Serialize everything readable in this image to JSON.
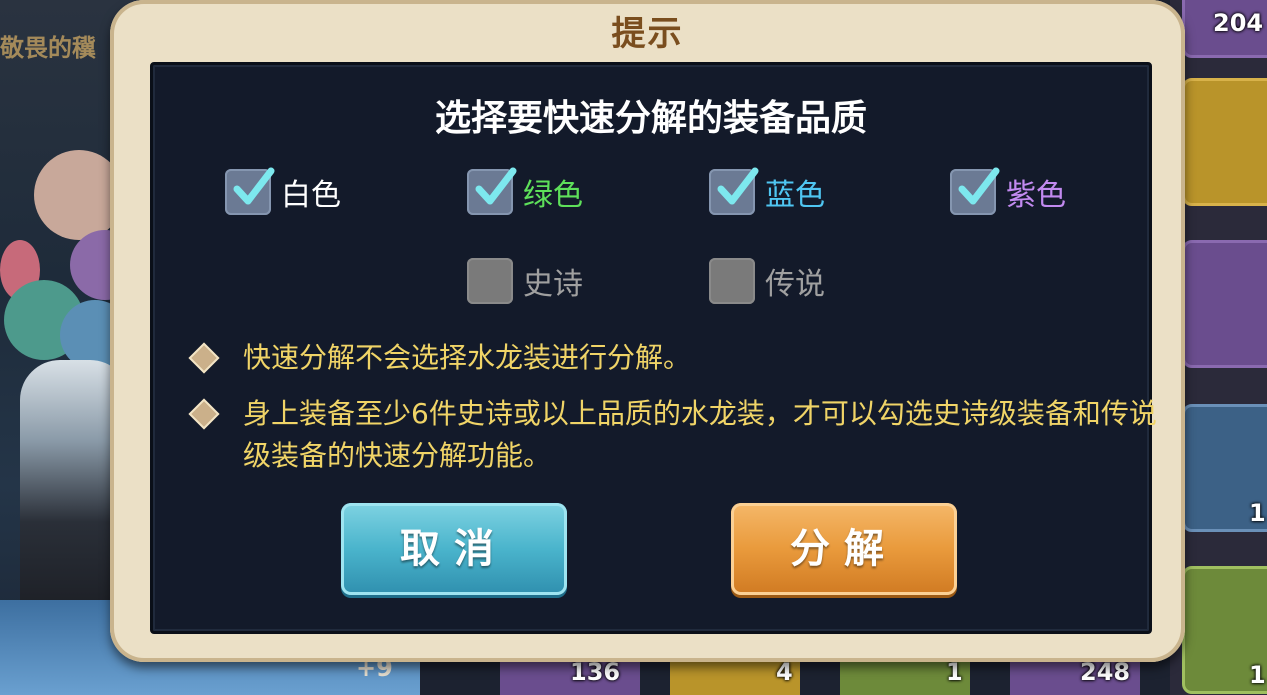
{
  "background": {
    "left_title": "敬畏的䆊",
    "bottom_enhance": "+9",
    "right_slot_counts": [
      "204",
      "1",
      "1"
    ],
    "bottom_slot_counts": [
      "136",
      "4",
      "1",
      "248"
    ]
  },
  "dialog": {
    "title": "提示",
    "heading": "选择要快速分解的装备品质",
    "options": [
      {
        "label": "白色",
        "checked": true,
        "enabled": true,
        "color": "#ffffff"
      },
      {
        "label": "绿色",
        "checked": true,
        "enabled": true,
        "color": "#5ee05a"
      },
      {
        "label": "蓝色",
        "checked": true,
        "enabled": true,
        "color": "#4fc6f2"
      },
      {
        "label": "紫色",
        "checked": true,
        "enabled": true,
        "color": "#c28af0"
      },
      {
        "label": "史诗",
        "checked": false,
        "enabled": false,
        "color": "#a0a0a0"
      },
      {
        "label": "传说",
        "checked": false,
        "enabled": false,
        "color": "#a0a0a0"
      }
    ],
    "notes": [
      "快速分解不会选择水龙装进行分解。",
      "身上装备至少6件史诗或以上品质的水龙装，才可以勾选史诗级装备和传说级装备的快速分解功能。"
    ],
    "cancel_label": "取消",
    "confirm_label": "分解"
  },
  "colors": {
    "accent_check": "#7de8ee",
    "note_text": "#f0d467",
    "title_brown": "#7a4e1e"
  }
}
